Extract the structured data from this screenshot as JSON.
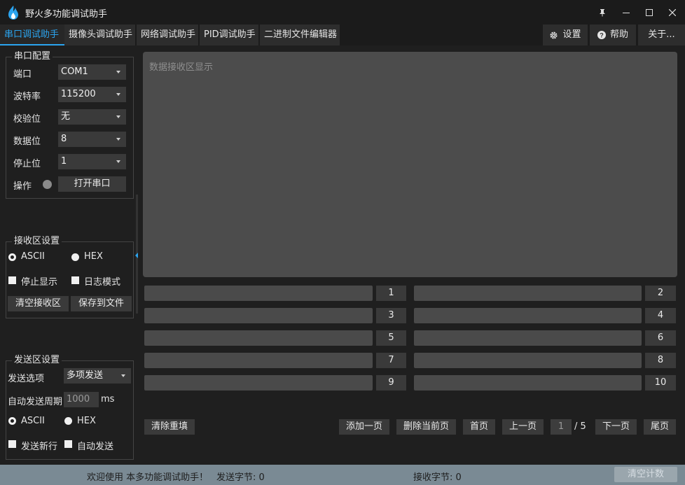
{
  "window": {
    "title": "野火多功能调试助手",
    "icons": {
      "pin": "pin-icon",
      "minimize": "minimize-icon",
      "maximize": "maximize-icon",
      "close": "close-icon"
    }
  },
  "tabs": [
    {
      "label": "串口调试助手",
      "active": true
    },
    {
      "label": "摄像头调试助手"
    },
    {
      "label": "网络调试助手"
    },
    {
      "label": "PID调试助手"
    },
    {
      "label": "二进制文件编辑器"
    }
  ],
  "menu": {
    "settings": "设置",
    "help": "帮助",
    "about": "关于..."
  },
  "serial_config": {
    "title": "串口配置",
    "port_label": "端口",
    "port_value": "COM1",
    "baud_label": "波特率",
    "baud_value": "115200",
    "parity_label": "校验位",
    "parity_value": "无",
    "databits_label": "数据位",
    "databits_value": "8",
    "stopbits_label": "停止位",
    "stopbits_value": "1",
    "op_label": "操作",
    "open_button": "打开串口"
  },
  "receive_settings": {
    "title": "接收区设置",
    "ascii": "ASCII",
    "hex": "HEX",
    "stop_display": "停止显示",
    "log_mode": "日志模式",
    "clear_button": "清空接收区",
    "save_button": "保存到文件"
  },
  "send_settings": {
    "title": "发送区设置",
    "option_label": "发送选项",
    "option_value": "多项发送",
    "period_label": "自动发送周期",
    "period_value": "1000",
    "period_unit": "ms",
    "ascii": "ASCII",
    "hex": "HEX",
    "newline": "发送新行",
    "auto_send": "自动发送"
  },
  "receive_area": {
    "placeholder": "数据接收区显示"
  },
  "send_slots": [
    "1",
    "2",
    "3",
    "4",
    "5",
    "6",
    "7",
    "8",
    "9",
    "10"
  ],
  "pager": {
    "clear_refill": "清除重填",
    "add_page": "添加一页",
    "delete_page": "删除当前页",
    "first": "首页",
    "prev": "上一页",
    "current": "1",
    "total": "/ 5",
    "next": "下一页",
    "last": "尾页"
  },
  "status": {
    "welcome": "欢迎使用 本多功能调试助手！",
    "sent": "发送字节: 0",
    "received": "接收字节: 0",
    "clear_count": "清空计数"
  },
  "colors": {
    "accent": "#2ba4ef",
    "statusbar": "#7a8a94"
  }
}
